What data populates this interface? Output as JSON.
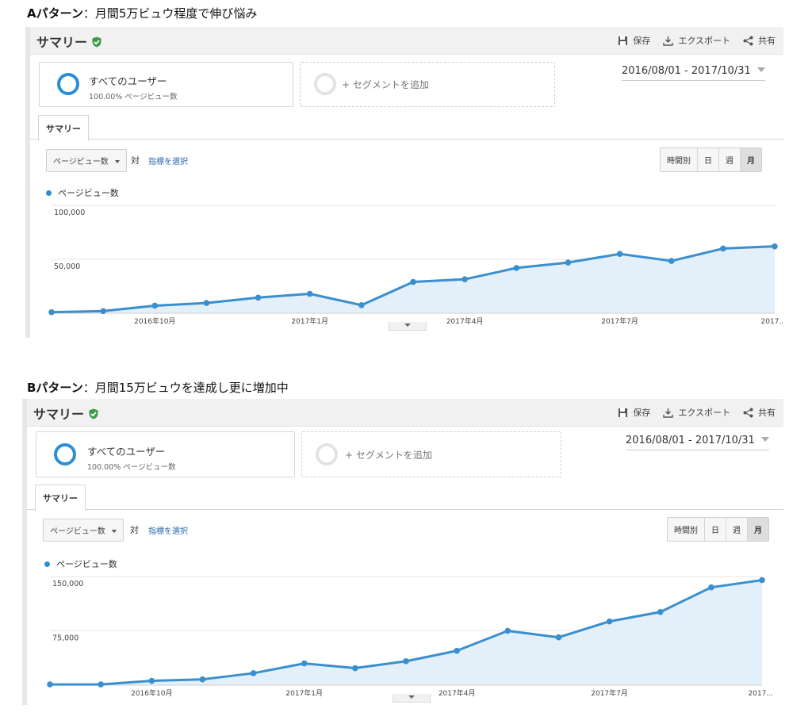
{
  "panels": [
    {
      "heading_bold": "Aパターン",
      "heading_rest": "：月間5万ビュウ程度で伸び悩み",
      "title": "サマリー",
      "actions": {
        "save": "保存",
        "export": "エクスポート",
        "share": "共有"
      },
      "segments": {
        "all_users": "すべてのユーザー",
        "all_users_sub": "100.00% ページビュー数",
        "add_segment": "+ セグメントを追加"
      },
      "date_range": "2016/08/01 - 2017/10/31",
      "tab": "サマリー",
      "metric_dropdown": "ページビュー数",
      "vs": "対",
      "select_metric": "指標を選択",
      "granularity": [
        "時間別",
        "日",
        "週",
        "月"
      ],
      "legend": "ページビュー数",
      "chart_data": {
        "type": "area",
        "x": [
          "2016-08",
          "2016-09",
          "2016-10",
          "2016-11",
          "2016-12",
          "2017-01",
          "2017-02",
          "2017-03",
          "2017-04",
          "2017-05",
          "2017-06",
          "2017-07",
          "2017-08",
          "2017-09",
          "2017-10"
        ],
        "series": [
          {
            "name": "ページビュー数",
            "values": [
              1000,
              2000,
              7000,
              9500,
              14500,
              18000,
              7500,
              29000,
              31500,
              42000,
              47000,
              55000,
              48500,
              60000,
              62000
            ]
          }
        ],
        "yticks": [
          "100,000",
          "50,000"
        ],
        "ytick_values": [
          100000,
          50000
        ],
        "xtick_labels": [
          "2016年10月",
          "2017年1月",
          "2017年4月",
          "2017年7月",
          "2017..."
        ],
        "xtick_index": [
          2,
          5,
          8,
          11,
          14
        ],
        "ylim": [
          0,
          100000
        ],
        "color": "#3a8fcf"
      }
    },
    {
      "heading_bold": "Bパターン",
      "heading_rest": "：月間15万ビュウを達成し更に増加中",
      "title": "サマリー",
      "actions": {
        "save": "保存",
        "export": "エクスポート",
        "share": "共有"
      },
      "segments": {
        "all_users": "すべてのユーザー",
        "all_users_sub": "100.00% ページビュー数",
        "add_segment": "+ セグメントを追加"
      },
      "date_range": "2016/08/01 - 2017/10/31",
      "tab": "サマリー",
      "metric_dropdown": "ページビュー数",
      "vs": "対",
      "select_metric": "指標を選択",
      "granularity": [
        "時間別",
        "日",
        "週",
        "月"
      ],
      "legend": "ページビュー数",
      "chart_data": {
        "type": "area",
        "x": [
          "2016-08",
          "2016-09",
          "2016-10",
          "2016-11",
          "2016-12",
          "2017-01",
          "2017-02",
          "2017-03",
          "2017-04",
          "2017-05",
          "2017-06",
          "2017-07",
          "2017-08",
          "2017-09",
          "2017-10"
        ],
        "series": [
          {
            "name": "ページビュー数",
            "values": [
              1000,
              1000,
              6000,
              8000,
              16500,
              30000,
              23500,
              33000,
              47500,
              75000,
              66000,
              88000,
              101000,
              135000,
              145000
            ]
          }
        ],
        "yticks": [
          "150,000",
          "75,000"
        ],
        "ytick_values": [
          150000,
          75000
        ],
        "xtick_labels": [
          "2016年10月",
          "2017年1月",
          "2017年4月",
          "2017年7月",
          "2017..."
        ],
        "xtick_index": [
          2,
          5,
          8,
          11,
          14
        ],
        "ylim": [
          0,
          150000
        ],
        "color": "#3a8fcf"
      }
    }
  ]
}
